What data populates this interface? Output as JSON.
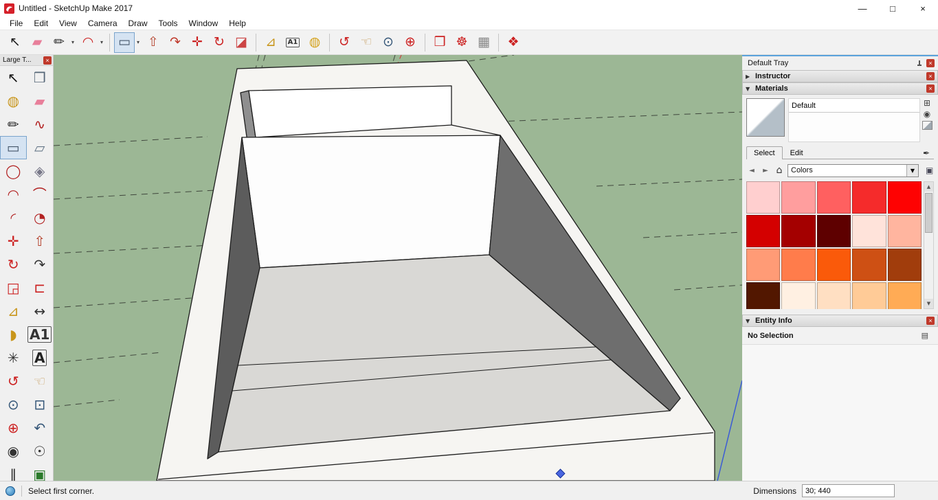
{
  "window": {
    "title": "Untitled - SketchUp Make 2017",
    "minimize": "—",
    "maximize": "□",
    "close": "×"
  },
  "menu": {
    "items": [
      "File",
      "Edit",
      "View",
      "Camera",
      "Draw",
      "Tools",
      "Window",
      "Help"
    ]
  },
  "toolbar": {
    "items": [
      {
        "type": "tool",
        "name": "select",
        "glyph": "↖",
        "color": "#1a1a1a"
      },
      {
        "type": "tool",
        "name": "eraser",
        "glyph": "▰",
        "color": "#e87f9a"
      },
      {
        "type": "tool",
        "name": "line",
        "glyph": "✏",
        "color": "#2a2a2a",
        "dropdown": true
      },
      {
        "type": "tool",
        "name": "arc",
        "glyph": "◠",
        "color": "#cc2222",
        "dropdown": true
      },
      {
        "type": "sep"
      },
      {
        "type": "tool",
        "name": "rectangle",
        "glyph": "▭",
        "color": "#44566a",
        "dropdown": true,
        "active": true
      },
      {
        "type": "tool",
        "name": "push-pull",
        "glyph": "⇧",
        "color": "#b5432e"
      },
      {
        "type": "tool",
        "name": "follow-me",
        "glyph": "↷",
        "color": "#c0392b"
      },
      {
        "type": "tool",
        "name": "move",
        "glyph": "✛",
        "color": "#cc2222"
      },
      {
        "type": "tool",
        "name": "rotate",
        "glyph": "↻",
        "color": "#cc2222"
      },
      {
        "type": "tool",
        "name": "section-plane",
        "glyph": "◪",
        "color": "#cc4444"
      },
      {
        "type": "sep"
      },
      {
        "type": "tool",
        "name": "tape-measure",
        "glyph": "⊿",
        "color": "#c8951a"
      },
      {
        "type": "tool",
        "name": "text",
        "glyph": "A1",
        "color": "#333333",
        "text_glyph": true
      },
      {
        "type": "tool",
        "name": "paint-bucket",
        "glyph": "◍",
        "color": "#d4a017"
      },
      {
        "type": "sep"
      },
      {
        "type": "tool",
        "name": "orbit",
        "glyph": "↺",
        "color": "#cc2222"
      },
      {
        "type": "tool",
        "name": "pan",
        "glyph": "☜",
        "color": "#c8a165"
      },
      {
        "type": "tool",
        "name": "zoom",
        "glyph": "⊙",
        "color": "#335577"
      },
      {
        "type": "tool",
        "name": "zoom-extents",
        "glyph": "⊕",
        "color": "#cc2222"
      },
      {
        "type": "sep"
      },
      {
        "type": "tool",
        "name": "component",
        "glyph": "❒",
        "color": "#cc2222"
      },
      {
        "type": "tool",
        "name": "warehouse",
        "glyph": "☸",
        "color": "#cc2222"
      },
      {
        "type": "tool",
        "name": "layout",
        "glyph": "▦",
        "color": "#888888"
      },
      {
        "type": "sep"
      },
      {
        "type": "tool",
        "name": "help",
        "glyph": "❖",
        "color": "#cc2222"
      }
    ]
  },
  "left_toolbar": {
    "title": "Large T...",
    "close": "×",
    "items": [
      {
        "name": "select",
        "glyph": "↖",
        "color": "#111111"
      },
      {
        "name": "make-component",
        "glyph": "❒",
        "color": "#556677"
      },
      {
        "name": "paint-bucket",
        "glyph": "◍",
        "color": "#c8951a"
      },
      {
        "name": "eraser",
        "glyph": "▰",
        "color": "#e87f9a"
      },
      {
        "name": "line",
        "glyph": "✏",
        "color": "#222222"
      },
      {
        "name": "freehand",
        "glyph": "∿",
        "color": "#b22222"
      },
      {
        "name": "rectangle",
        "glyph": "▭",
        "color": "#44566a",
        "active": true
      },
      {
        "name": "rotated-rectangle",
        "glyph": "▱",
        "color": "#667788"
      },
      {
        "name": "circle",
        "glyph": "◯",
        "color": "#b22222"
      },
      {
        "name": "polygon",
        "glyph": "◈",
        "color": "#777788"
      },
      {
        "name": "arc",
        "glyph": "◠",
        "color": "#b22222"
      },
      {
        "name": "two-point-arc",
        "glyph": "⌒",
        "color": "#b22222"
      },
      {
        "name": "three-point-arc",
        "glyph": "◜",
        "color": "#b22222"
      },
      {
        "name": "pie",
        "glyph": "◔",
        "color": "#b22222"
      },
      {
        "name": "move",
        "glyph": "✛",
        "color": "#cc2222"
      },
      {
        "name": "push-pull",
        "glyph": "⇧",
        "color": "#b5432e"
      },
      {
        "name": "rotate",
        "glyph": "↻",
        "color": "#cc2222"
      },
      {
        "name": "follow-me",
        "glyph": "↷",
        "color": "#333333"
      },
      {
        "name": "scale",
        "glyph": "◲",
        "color": "#cc2222"
      },
      {
        "name": "offset",
        "glyph": "⊏",
        "color": "#cc2222"
      },
      {
        "name": "tape-measure",
        "glyph": "⊿",
        "color": "#c8951a"
      },
      {
        "name": "dimensions",
        "glyph": "↔",
        "color": "#333333"
      },
      {
        "name": "protractor",
        "glyph": "◗",
        "color": "#c8951a"
      },
      {
        "name": "text",
        "glyph": "A1",
        "color": "#333333",
        "text_glyph": true
      },
      {
        "name": "axes",
        "glyph": "✳",
        "color": "#333333"
      },
      {
        "name": "3d-text",
        "glyph": "A",
        "color": "#222222",
        "text_glyph": true
      },
      {
        "name": "orbit",
        "glyph": "↺",
        "color": "#cc2222"
      },
      {
        "name": "pan",
        "glyph": "☜",
        "color": "#c8a165"
      },
      {
        "name": "zoom",
        "glyph": "⊙",
        "color": "#335577"
      },
      {
        "name": "zoom-window",
        "glyph": "⊡",
        "color": "#335577"
      },
      {
        "name": "zoom-extents",
        "glyph": "⊕",
        "color": "#cc2222"
      },
      {
        "name": "zoom-previous",
        "glyph": "↶",
        "color": "#335577"
      },
      {
        "name": "position-camera",
        "glyph": "◉",
        "color": "#333333"
      },
      {
        "name": "look-around",
        "glyph": "☉",
        "color": "#333333"
      },
      {
        "name": "walk",
        "glyph": "‖",
        "color": "#333333"
      },
      {
        "name": "section-plane-lt",
        "glyph": "▣",
        "color": "#2a7a2a"
      }
    ]
  },
  "viewport": {
    "ground_color": "#9CB795"
  },
  "tray": {
    "title": "Default Tray",
    "close": "×",
    "panels": {
      "instructor": {
        "label": "Instructor",
        "arrow": "▶",
        "close": "×"
      },
      "materials": {
        "label": "Materials",
        "arrow": "▼",
        "close": "×",
        "material_name": "Default",
        "tabs": [
          {
            "label": "Select"
          },
          {
            "label": "Edit"
          }
        ],
        "collection": "Colors",
        "swatch_rows": [
          [
            "#FFCFCF",
            "#FF9E9E",
            "#FF6060",
            "#F52B2B",
            "#FE0202"
          ],
          [
            "#D40000",
            "#A40000",
            "#5E0000",
            "#FFE3DA",
            "#FFB59F"
          ],
          [
            "#FF9B76",
            "#FF7C4B",
            "#FA5A0A",
            "#CE5014",
            "#A13D0C"
          ],
          [
            "#521700",
            "#FFF0E2",
            "#FFDFC2",
            "#FFCB97",
            "#FFAB55"
          ]
        ]
      },
      "entity_info": {
        "label": "Entity Info",
        "arrow": "▼",
        "close": "×",
        "content": "No Selection"
      }
    }
  },
  "status_bar": {
    "message": "Select first corner.",
    "dimensions_label": "Dimensions",
    "dimensions_value": "30; 440"
  }
}
